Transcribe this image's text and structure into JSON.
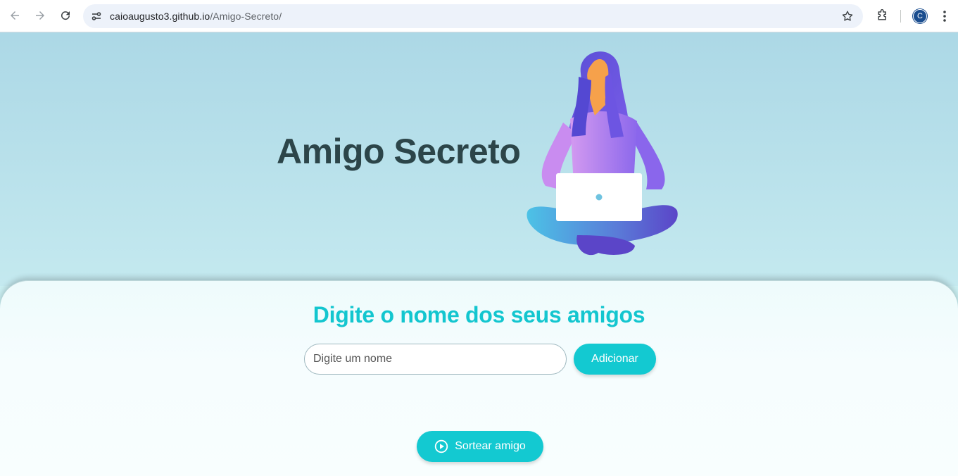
{
  "browser": {
    "url_host": "caioaugusto3.github.io",
    "url_path": "/Amigo-Secreto/",
    "profile_initial": "C",
    "icons": [
      "back-arrow-icon",
      "forward-arrow-icon",
      "reload-icon",
      "site-info-icon",
      "bookmark-star-icon",
      "extensions-puzzle-icon",
      "more-menu-icon"
    ]
  },
  "hero": {
    "title": "Amigo Secreto",
    "illustration": "woman-with-laptop-illustration"
  },
  "form": {
    "heading": "Digite o nome dos seus amigos",
    "name_input": {
      "value": "",
      "placeholder": "Digite um nome"
    },
    "add_button": "Adicionar",
    "draw_button": "Sortear amigo",
    "draw_icon": "play-circle-icon"
  },
  "colors": {
    "accent": "#13c9d1",
    "title": "#2c4549",
    "hero_top": "#acd8e6",
    "hero_bottom": "#c4e9ef"
  }
}
